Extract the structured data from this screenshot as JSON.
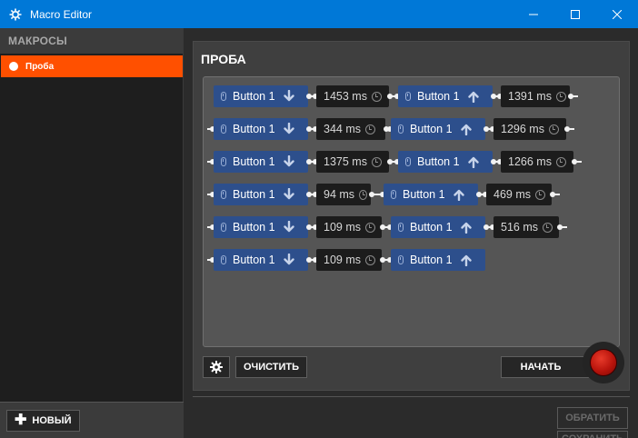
{
  "window": {
    "title": "Macro Editor"
  },
  "sidebar": {
    "header": "МАКРОСЫ",
    "items": [
      {
        "label": "Проба",
        "selected": true
      }
    ],
    "new_button": "НОВЫЙ"
  },
  "editor": {
    "title": "ПРОБА",
    "clear_button": "ОЧИСТИТЬ",
    "start_button": "НАЧАТЬ",
    "apply_button": "ОБРАТИТЬ",
    "save_button": "СОХРАНИТЬ"
  },
  "sequence": [
    {
      "button": "Button 1",
      "down_delay": "1453 ms",
      "up_delay": "1391 ms"
    },
    {
      "button": "Button 1",
      "down_delay": "344 ms",
      "up_delay": "1296 ms"
    },
    {
      "button": "Button 1",
      "down_delay": "1375 ms",
      "up_delay": "1266 ms"
    },
    {
      "button": "Button 1",
      "down_delay": "94 ms",
      "up_delay": "469 ms"
    },
    {
      "button": "Button 1",
      "down_delay": "109 ms",
      "up_delay": "516 ms"
    },
    {
      "button": "Button 1",
      "down_delay": "109 ms",
      "up_delay": ""
    }
  ],
  "icons": {
    "app": "steelseries-icon",
    "minimize": "minimize-icon",
    "maximize": "maximize-icon",
    "close": "close-icon",
    "mouse": "mouse-icon",
    "arrow_down": "arrow-down-icon",
    "arrow_up": "arrow-up-icon",
    "clock": "clock-icon",
    "gear": "gear-icon",
    "plus": "plus-icon",
    "record": "record-icon"
  },
  "colors": {
    "titlebar": "#0078d7",
    "accent": "#ff5000",
    "button_block": "#2d4f8c",
    "delay_block": "#1c1c1c",
    "record": "#c8160d"
  }
}
